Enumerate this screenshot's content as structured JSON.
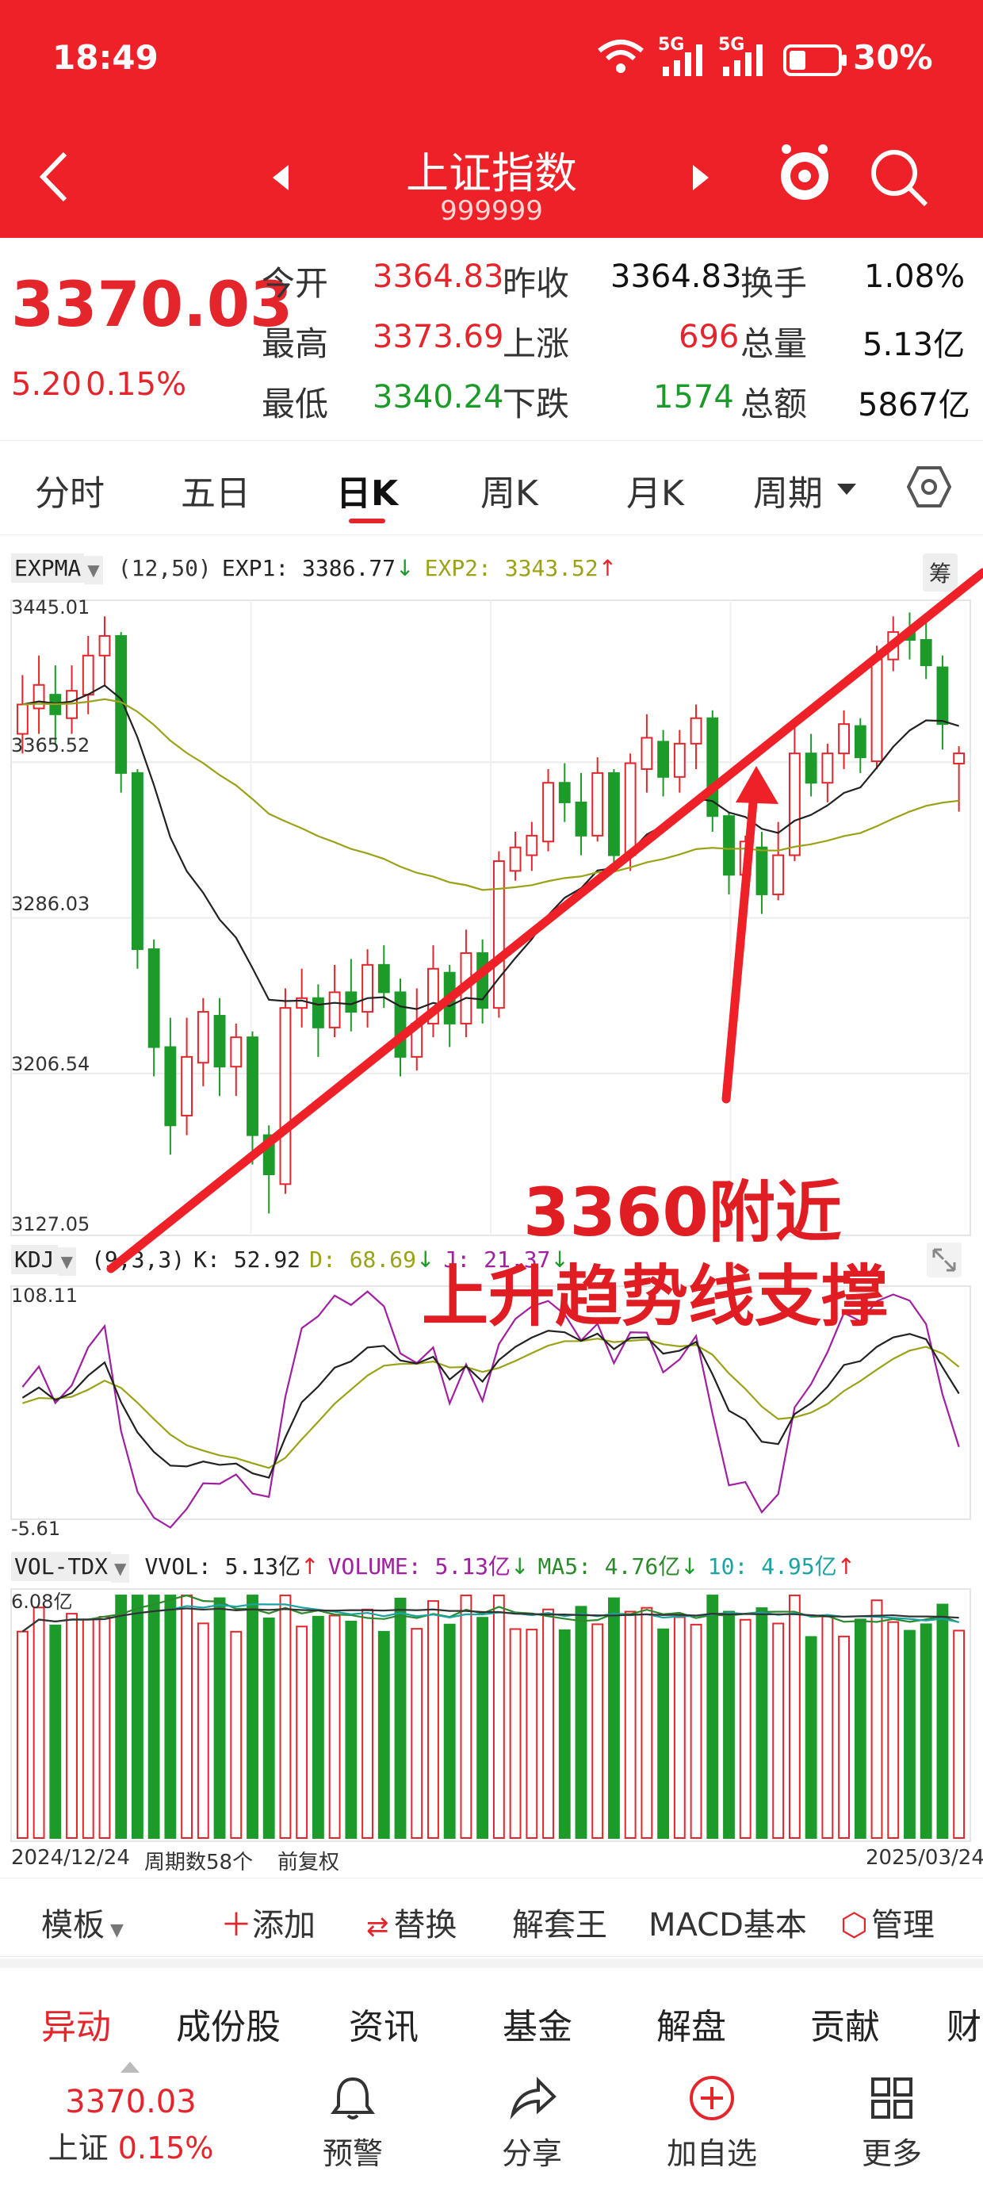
{
  "status": {
    "time": "18:49",
    "battery": "30%",
    "net1": "5G",
    "net2": "5G"
  },
  "nav": {
    "title": "上证指数",
    "code": "999999"
  },
  "quote": {
    "price": "3370.03",
    "change": "5.20",
    "pct": "0.15%",
    "rows": [
      [
        {
          "l": "今开",
          "v": "3364.83",
          "c": "red"
        },
        {
          "l": "昨收",
          "v": "3364.83",
          "c": "black"
        },
        {
          "l": "换手",
          "v": "1.08%",
          "c": "black"
        }
      ],
      [
        {
          "l": "最高",
          "v": "3373.69",
          "c": "red"
        },
        {
          "l": "上涨",
          "v": "696",
          "c": "red"
        },
        {
          "l": "总量",
          "v": "5.13亿",
          "c": "black"
        }
      ],
      [
        {
          "l": "最低",
          "v": "3340.24",
          "c": "green"
        },
        {
          "l": "下跌",
          "v": "1574",
          "c": "green"
        },
        {
          "l": "总额",
          "v": "5867亿",
          "c": "black"
        }
      ]
    ]
  },
  "tabs": [
    "分时",
    "五日",
    "日K",
    "周K",
    "月K",
    "周期"
  ],
  "tabs_active": 2,
  "expma": {
    "name": "EXPMA",
    "params": "(12,50)",
    "e1": "EXP1: 3386.77",
    "e2": "EXP2: 3343.52",
    "chip": "筹"
  },
  "price_axis": [
    "3445.01",
    "3365.52",
    "3286.03",
    "3206.54",
    "3127.05"
  ],
  "kdj": {
    "name": "KDJ",
    "params": "(9,3,3)",
    "k": "K: 52.92",
    "d": "D: 68.69",
    "j": "J: 21.37",
    "top": "108.11",
    "bottom": "-5.61"
  },
  "vol": {
    "name": "VOL-TDX",
    "vvol": "VVOL: 5.13亿",
    "volume": "VOLUME: 5.13亿",
    "ma5": "MA5: 4.76亿",
    "ma10": "10: 4.95亿",
    "top": "6.08亿"
  },
  "footer_axis": {
    "start": "2024/12/24",
    "period": "周期数58个",
    "adj": "前复权",
    "end": "2025/03/24"
  },
  "annotation": {
    "line1": "3360附近",
    "line2": "上升趋势线支撑"
  },
  "toolbar": [
    "模板",
    "添加",
    "替换",
    "解套王",
    "MACD基本",
    "管理"
  ],
  "bottom_tabs": [
    "异动",
    "成份股",
    "资讯",
    "基金",
    "解盘",
    "贡献",
    "财"
  ],
  "bottom_tabs_active": 0,
  "footer": {
    "price": "3370.03",
    "name": "上证",
    "pct": "0.15%",
    "items": [
      "预警",
      "分享",
      "加自选",
      "更多"
    ]
  },
  "colors": {
    "brand": "#ee2128",
    "up": "#e4262c",
    "down": "#1d9b2a",
    "ema1": "#222222",
    "ema2": "#9aa317",
    "kdj_j": "#a020a0"
  },
  "chart_data": {
    "type": "candlestick",
    "x": [
      "2024/12/24",
      "2025/03/24"
    ],
    "period_count": 58,
    "ylim": [
      3127.05,
      3445.01
    ],
    "candles": [
      [
        3380,
        3395,
        3370,
        3410
      ],
      [
        3393,
        3405,
        3380,
        3420
      ],
      [
        3400,
        3390,
        3375,
        3415
      ],
      [
        3388,
        3402,
        3380,
        3415
      ],
      [
        3400,
        3420,
        3390,
        3430
      ],
      [
        3420,
        3430,
        3405,
        3440
      ],
      [
        3430,
        3360,
        3350,
        3432
      ],
      [
        3360,
        3270,
        3260,
        3362
      ],
      [
        3270,
        3220,
        3205,
        3275
      ],
      [
        3220,
        3180,
        3165,
        3235
      ],
      [
        3185,
        3215,
        3175,
        3235
      ],
      [
        3212,
        3238,
        3200,
        3245
      ],
      [
        3236,
        3210,
        3195,
        3245
      ],
      [
        3210,
        3225,
        3195,
        3232
      ],
      [
        3225,
        3175,
        3160,
        3228
      ],
      [
        3175,
        3155,
        3135,
        3180
      ],
      [
        3150,
        3240,
        3145,
        3250
      ],
      [
        3240,
        3245,
        3230,
        3260
      ],
      [
        3245,
        3230,
        3215,
        3252
      ],
      [
        3230,
        3248,
        3225,
        3262
      ],
      [
        3248,
        3238,
        3228,
        3265
      ],
      [
        3238,
        3262,
        3230,
        3270
      ],
      [
        3262,
        3248,
        3240,
        3272
      ],
      [
        3248,
        3215,
        3205,
        3255
      ],
      [
        3215,
        3232,
        3208,
        3250
      ],
      [
        3232,
        3260,
        3225,
        3272
      ],
      [
        3258,
        3232,
        3220,
        3262
      ],
      [
        3232,
        3268,
        3225,
        3280
      ],
      [
        3268,
        3240,
        3232,
        3275
      ],
      [
        3240,
        3315,
        3235,
        3320
      ],
      [
        3310,
        3322,
        3305,
        3330
      ],
      [
        3318,
        3328,
        3310,
        3335
      ],
      [
        3325,
        3355,
        3320,
        3362
      ],
      [
        3355,
        3345,
        3335,
        3365
      ],
      [
        3345,
        3328,
        3318,
        3360
      ],
      [
        3328,
        3360,
        3325,
        3368
      ],
      [
        3360,
        3318,
        3312,
        3362
      ],
      [
        3318,
        3365,
        3310,
        3370
      ],
      [
        3362,
        3378,
        3350,
        3390
      ],
      [
        3376,
        3358,
        3348,
        3382
      ],
      [
        3358,
        3375,
        3350,
        3382
      ],
      [
        3375,
        3388,
        3362,
        3395
      ],
      [
        3388,
        3338,
        3330,
        3392
      ],
      [
        3338,
        3308,
        3298,
        3340
      ],
      [
        3308,
        3325,
        3290,
        3328
      ],
      [
        3322,
        3298,
        3288,
        3330
      ],
      [
        3298,
        3318,
        3295,
        3335
      ],
      [
        3318,
        3370,
        3315,
        3388
      ],
      [
        3370,
        3355,
        3348,
        3380
      ],
      [
        3355,
        3370,
        3345,
        3375
      ],
      [
        3370,
        3385,
        3362,
        3392
      ],
      [
        3384,
        3368,
        3360,
        3388
      ],
      [
        3366,
        3418,
        3362,
        3425
      ],
      [
        3418,
        3432,
        3412,
        3440
      ],
      [
        3432,
        3428,
        3418,
        3442
      ],
      [
        3428,
        3415,
        3408,
        3438
      ],
      [
        3414,
        3385,
        3372,
        3420
      ],
      [
        3364.83,
        3370.03,
        3340.24,
        3373.69
      ]
    ]
  }
}
